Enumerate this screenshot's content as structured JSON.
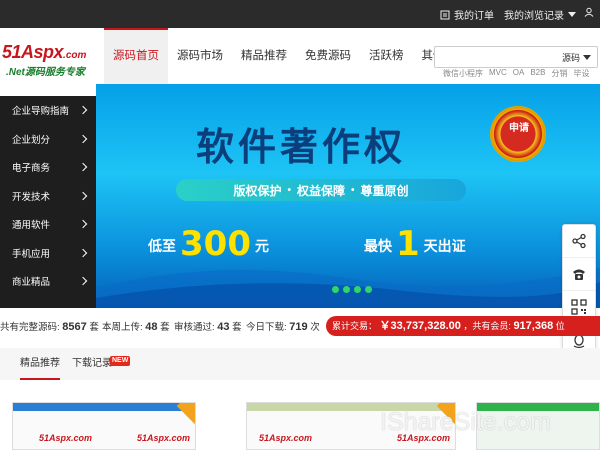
{
  "topbar": {
    "my_orders": "我的订单",
    "my_history": "我的浏览记录"
  },
  "logo": {
    "main": "51Aspx",
    "domain": ".com",
    "slogan": ".Net源码服务专家"
  },
  "nav": {
    "items": [
      "源码首页",
      "源码市场",
      "精品推荐",
      "免费源码",
      "活跃榜",
      "其他语言"
    ],
    "active_index": 0
  },
  "search": {
    "type": "源码",
    "hot_tags": [
      "微信小程序",
      "MVC",
      "OA",
      "B2B",
      "分销",
      "毕设"
    ]
  },
  "sidebar": {
    "items": [
      "企业导购指南",
      "企业划分",
      "电子商务",
      "开发技术",
      "通用软件",
      "手机应用",
      "商业精品"
    ]
  },
  "banner": {
    "title": "软件著作权",
    "seal_text": "申请",
    "tags": [
      "版权保护",
      "权益保障",
      "尊重原创"
    ],
    "price_prefix": "低至",
    "price": "300",
    "price_unit": "元",
    "speed_prefix": "最快",
    "speed_value": "1",
    "speed_suffix": "天出证",
    "slide_count": 4
  },
  "stats": {
    "total_label": "共有完整源码:",
    "total_value": "8567",
    "unit_tao": "套",
    "week_label": "本周上传:",
    "week_value": "48",
    "audit_label": "审核通过:",
    "audit_value": "43",
    "today_label": "今日下载:",
    "today_value": "719",
    "unit_ci": "次",
    "trade_label": "累计交易：",
    "trade_value": "￥33,737,328.00",
    "members_label": "，共有会员:",
    "members_value": "917,368",
    "members_unit": "位"
  },
  "tabs": {
    "featured": "精品推荐",
    "download_history": "下载记录",
    "new_badge": "NEW"
  },
  "thumbs": {
    "logo_text": "51Aspx",
    "domain": ".com"
  },
  "watermark": "IShareSite.com",
  "colors": {
    "brand_red": "#c8161d",
    "topbar_bg": "#2b2b2b",
    "sidebar_bg": "#1e1e1e",
    "banner_blue": "#1ec4f5",
    "price_yellow": "#ffe100"
  }
}
